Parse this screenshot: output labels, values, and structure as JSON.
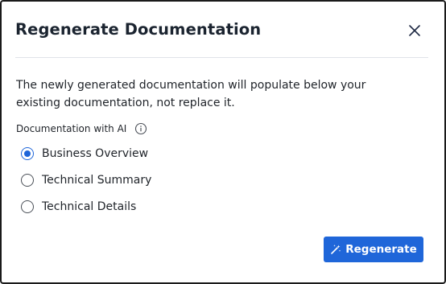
{
  "dialog": {
    "title": "Regenerate Documentation",
    "description": "The newly generated documentation will populate below your existing documentation, not replace it.",
    "section_label": "Documentation with AI",
    "options": [
      {
        "label": "Business Overview",
        "selected": true
      },
      {
        "label": "Technical Summary",
        "selected": false
      },
      {
        "label": "Technical Details",
        "selected": false
      }
    ],
    "primary_button_label": "Regenerate"
  },
  "colors": {
    "accent": "#1f66d9",
    "title_text": "#1b2430",
    "body_text": "#1f2329",
    "divider": "#e0e3e8"
  },
  "icons": {
    "close": "close-icon",
    "info": "info-icon",
    "regenerate": "magic-wand-icon"
  }
}
